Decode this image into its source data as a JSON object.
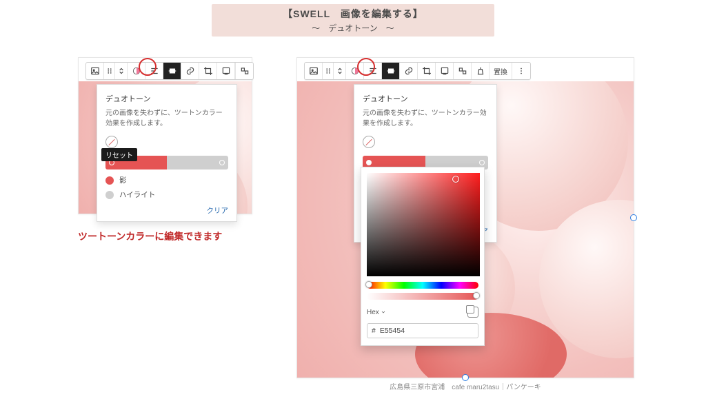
{
  "header": {
    "title_line1": "【SWELL　画像を編集する】",
    "title_line2": "〜　デュオトーン　〜"
  },
  "note": "ツートーンカラーに編集できます",
  "toolbar": {
    "replace_label": "置換"
  },
  "duotone_panel": {
    "heading": "デュオトーン",
    "description": "元の画像を失わずに、ツートンカラー効果を作成します。",
    "reset_tooltip": "リセット",
    "shadow_label": "影",
    "highlight_label": "ハイライト",
    "clear_label": "クリア"
  },
  "color_picker": {
    "mode_label": "Hex",
    "hex_value": "E55454",
    "color": "#E55454"
  },
  "caption": "広島県三原市宮浦　cafe maru2tasu｜パンケーキ"
}
